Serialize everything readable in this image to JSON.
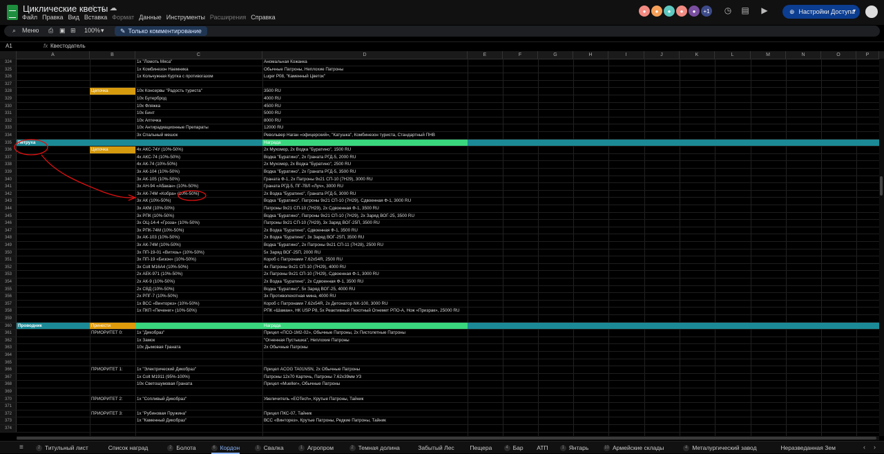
{
  "app": {
    "title": "Циклические квесты",
    "menus": [
      "Файл",
      "Правка",
      "Вид",
      "Вставка",
      "Формат",
      "Данные",
      "Инструменты",
      "Расширения",
      "Справка"
    ],
    "dim_menus": [
      "Формат",
      "Расширения"
    ],
    "avatars_extra": "+1",
    "share_label": "Настройки Доступа"
  },
  "toolbar": {
    "menu_label": "Меню",
    "zoom": "100%",
    "comment_mode": "Только комментирование"
  },
  "formula_bar": {
    "cell_ref": "A1",
    "fx": "fx",
    "content": "Квестодатель"
  },
  "columns": [
    "A",
    "B",
    "C",
    "D",
    "E",
    "F",
    "G",
    "H",
    "I",
    "J",
    "K",
    "L",
    "M",
    "N",
    "O",
    "P"
  ],
  "rows": [
    {
      "n": "324",
      "c": "1x \"Ломоть Мяса\"",
      "d": " Аномальная Кожанка"
    },
    {
      "n": "325",
      "c": "1x Комбинезон Наемника",
      "d": "Обычные Патроны, Неплохие Патроны"
    },
    {
      "n": "326",
      "c": "1x Кольчужная Куртка с противогазом",
      "d": "Luger P08, \"Каменный Цветок\""
    },
    {
      "n": "327"
    },
    {
      "n": "328",
      "b": "Цепочка",
      "bStyle": "chain",
      "c": "10x Консервы \"Радость туриста\"",
      "d": "3500 RU"
    },
    {
      "n": "329",
      "c": "10x Бутерброд",
      "d": "4000 RU"
    },
    {
      "n": "330",
      "c": "10x Фляжка",
      "d": "4500 RU"
    },
    {
      "n": "331",
      "c": "10x Бинт",
      "d": "5000 RU"
    },
    {
      "n": "332",
      "c": "10x Аптечка",
      "d": " 8000 RU"
    },
    {
      "n": "333",
      "c": "10x Антирадиационные Препараты",
      "d": "12000 RU"
    },
    {
      "n": "334",
      "c": "3x Спальный мешок",
      "d": "Револьвер Наган «офицерский», \"Катушка\", Комбинезон туриста, Стандартный ПНВ"
    },
    {
      "n": "335",
      "a": "Петруха",
      "d": "Награда",
      "header": "teal"
    },
    {
      "n": "336",
      "b": "Цепочка",
      "bStyle": "chain",
      "c": "4x АКС-74У (10%-50%)",
      "d": "2x Мухомор, 2x Водка \"Буратино\", 1500 RU"
    },
    {
      "n": "337",
      "c": "4x АКС-74 (10%-50%)",
      "d": "Водка \"Буратино\", 2x Граната РГД-5, 2000 RU"
    },
    {
      "n": "338",
      "c": "4x АК-74 (10%-50%)",
      "d": "2x Мухомор, 2x Водка \"Буратино\", 2500 RU"
    },
    {
      "n": "339",
      "c": "3x АК-104 (10%-50%)",
      "d": "Водка \"Буратино\", 2x Граната РГД-5, 3500 RU"
    },
    {
      "n": "340",
      "c": "3x АК-105 (10%-50%)",
      "d": "Граната Ф-1, 2x Патроны 9x21 СП-10 (7Н29), 3000 RU"
    },
    {
      "n": "341",
      "c": "3x АН-94 «Абакан» (10%-50%)",
      "d": "Граната РГД-5, ПГ-7ВЛ «Луч», 3000 RU"
    },
    {
      "n": "342",
      "c": "3x АК-74М «Кобра» (10%-50%)",
      "d": "2x Водка \"Буратино\", Граната РГД-5, 3000 RU"
    },
    {
      "n": "343",
      "c": "3x АК (10%-50%)",
      "d": "Водка \"Буратино\", Патроны 9x21 СП-10 (7Н29), Сдвоенная Ф-1, 3000 RU"
    },
    {
      "n": "344",
      "c": "3x АКМ (10%-50%)",
      "d": "Патроны 9x21 СП-10 (7Н29), 2x Сдвоенная Ф-1, 3500 RU"
    },
    {
      "n": "345",
      "c": "3x РПК (10%-50%)",
      "d": "Водка \"Буратино\", Патроны 9x21 СП-10 (7Н29), 2x Заряд ВОГ-25, 3500 RU"
    },
    {
      "n": "346",
      "c": "3x ОЦ-14-4 «Гроза» (10%-50%)",
      "d": "Патроны 9x21 СП-10 (7Н29), 3x Заряд ВОГ-25П, 3500 RU"
    },
    {
      "n": "347",
      "c": "3x РПК-74М (10%-50%)",
      "d": "2x Водка \"Буратино\", Сдвоенная Ф-1, 3500 RU"
    },
    {
      "n": "348",
      "c": "3x АК-103 (10%-50%)",
      "d": "2x Водка \"Буратино\", 3x Заряд ВОГ-25П, 3500 RU"
    },
    {
      "n": "349",
      "c": "3x АК-74М (10%-50%)",
      "d": "Водка \"Буратино\", 2x Патроны 9x21 СП-11 (7Н28), 2500 RU"
    },
    {
      "n": "350",
      "c": "3x ПП-19-01 «Витязь» (10%-50%)",
      "d": "5x Заряд ВОГ-25П, 2000 RU"
    },
    {
      "n": "351",
      "c": "3x ПП-19 «Бизон» (10%-50%)",
      "d": "Короб с Патронами 7.62x54R, 2500 RU"
    },
    {
      "n": "352",
      "c": "3x Colt M16A4 (10%-50%)",
      "d": "4x Патроны 9x21 СП-10 (7Н29), 4000 RU"
    },
    {
      "n": "353",
      "c": "2x АЕК-971 (10%-50%)",
      "d": " 2x Патроны 9x21 СП-10 (7Н29), Сдвоенная Ф-1, 3000 RU"
    },
    {
      "n": "354",
      "c": "2x АК-9 (10%-50%)",
      "d": "2x Водка \"Буратино\", 2x Сдвоенная Ф-1, 3500 RU"
    },
    {
      "n": "355",
      "c": "2x СВД (10%-50%)",
      "d": "Водка \"Буратино\", 5x Заряд ВОГ-25, 4000 RU"
    },
    {
      "n": "356",
      "c": "2x РПГ-7 (10%-50%)",
      "d": "3x Противопехотная мина, 4000 RU"
    },
    {
      "n": "357",
      "c": "1x ВСС «Винторез» (10%-50%)",
      "d": "Короб с Патронами 7.62x54R, 2x Детонатор NK-100, 3000 RU"
    },
    {
      "n": "358",
      "c": "1x ПКП «Печенег» (10%-50%)",
      "d": "РПК «Шаман», НК USP P8, 5x Реактивный Пехотный Огнемет РПО-А, Нож «Призрак», 25000 RU"
    },
    {
      "n": "359"
    },
    {
      "n": "360",
      "a": "Проводник",
      "b": "Принести",
      "d": "Награда",
      "header": "green"
    },
    {
      "n": "361",
      "b": "ПРИОРИТЕТ 0:",
      "c": "1x \"Дикобраз\"",
      "d": "Прицел «ПСО-1М2-02», Обычные Патроны, 2x Пистолетные Патроны"
    },
    {
      "n": "362",
      "c": "1x Замок",
      "d": "\"Огненная Пустышка\", Неплохие Патроны"
    },
    {
      "n": "363",
      "c": "10x Дымовая Граната",
      "d": "2x Обычные Патроны"
    },
    {
      "n": "364"
    },
    {
      "n": "365"
    },
    {
      "n": "366",
      "b": "ПРИОРИТЕТ 1:",
      "c": "1x \"Электрический Дикобраз\"",
      "d": "Прицел ACOG TA01NSN, 2x Обычные Патроны"
    },
    {
      "n": "367",
      "c": "1x Colt M1911 (95%-100%)",
      "d": "Патроны 12x70 Картечь, Патроны 7.62x39мм УЗ"
    },
    {
      "n": "368",
      "c": "10x Светошумовая Граната",
      "d": "Прицел «Mueller», Обычные Патроны"
    },
    {
      "n": "369"
    },
    {
      "n": "370",
      "b": "ПРИОРИТЕТ 2:",
      "c": "1x \"Сопливый Дикобраз\"",
      "d": "Увеличитель «EOTech», Крутые Патроны, Тайник"
    },
    {
      "n": "371"
    },
    {
      "n": "372",
      "b": "ПРИОРИТЕТ 3:",
      "c": "1x \"Рубиновая Пружина\"",
      "d": "Прицел ПКС-07, Тайник"
    },
    {
      "n": "373",
      "c": "1x \"Каменный Дикобраз\"",
      "d": " ВСС «Винторез», Крутые Патроны, Редкие Патроны, Тайник"
    },
    {
      "n": "374"
    }
  ],
  "tabs": [
    {
      "badge": "2",
      "label": "Титульный лист"
    },
    {
      "badge": "",
      "label": "Список наград"
    },
    {
      "badge": "2",
      "label": "Болота"
    },
    {
      "badge": "6",
      "label": "Кордон",
      "active": true
    },
    {
      "badge": "1",
      "label": "Свалка"
    },
    {
      "badge": "1",
      "label": "Агропром"
    },
    {
      "badge": "2",
      "label": "Темная долина"
    },
    {
      "badge": "",
      "label": "Забытый Лес"
    },
    {
      "badge": "",
      "label": "Пещера"
    },
    {
      "badge": "4",
      "label": "Бар"
    },
    {
      "badge": "",
      "label": "АТП"
    },
    {
      "badge": "1",
      "label": "Янтарь"
    },
    {
      "badge": "10",
      "label": "Армейские склады"
    },
    {
      "badge": "4",
      "label": "Металургический завод"
    },
    {
      "badge": "",
      "label": "Неразведанная Зем"
    }
  ],
  "colors": {
    "chain": "#d69a0e",
    "teal_header": "#1b8a96",
    "green_header": "#39d67e",
    "green_header_b": "#e09b0c",
    "annotation": "#e01010"
  }
}
